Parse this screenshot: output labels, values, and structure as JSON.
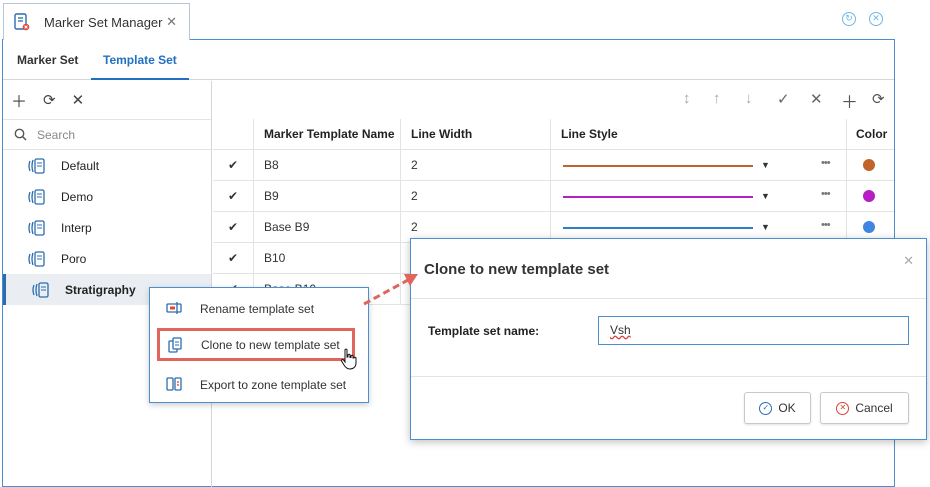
{
  "window": {
    "tab_title": "Marker Set Manager",
    "close": "✕"
  },
  "tabs": [
    {
      "label": "Marker Set"
    },
    {
      "label": "Template Set"
    }
  ],
  "left_panel": {
    "search_placeholder": "Search",
    "items": [
      {
        "label": "Default"
      },
      {
        "label": "Demo"
      },
      {
        "label": "Interp"
      },
      {
        "label": "Poro"
      },
      {
        "label": "Stratigraphy"
      }
    ]
  },
  "grid": {
    "headers": {
      "name": "Marker Template Name",
      "line_width": "Line Width",
      "line_style": "Line Style",
      "color": "Color"
    },
    "rows": [
      {
        "name": "B8",
        "line_width": "2",
        "line_color": "#c0652a",
        "color": "#c0652a"
      },
      {
        "name": "B9",
        "line_width": "2",
        "line_color": "#b51fc4",
        "color": "#b51fc4"
      },
      {
        "name": "Base B9",
        "line_width": "2",
        "line_color": "#2f7ec4",
        "color": "#3e86e0"
      },
      {
        "name": "B10",
        "line_width": "",
        "line_color": "",
        "color": ""
      },
      {
        "name": "Base B10",
        "line_width": "",
        "line_color": "",
        "color": ""
      }
    ]
  },
  "context_menu": {
    "items": [
      {
        "label": "Rename template set"
      },
      {
        "label": "Clone to new template set"
      },
      {
        "label": "Export to zone template set"
      }
    ]
  },
  "dialog": {
    "title": "Clone to new template set",
    "field_label": "Template set name:",
    "field_value": "Vsh",
    "ok_label": "OK",
    "cancel_label": "Cancel"
  },
  "colors": {
    "accent": "#2270c0",
    "highlight": "#e0655a",
    "border": "#4b8fcf"
  }
}
